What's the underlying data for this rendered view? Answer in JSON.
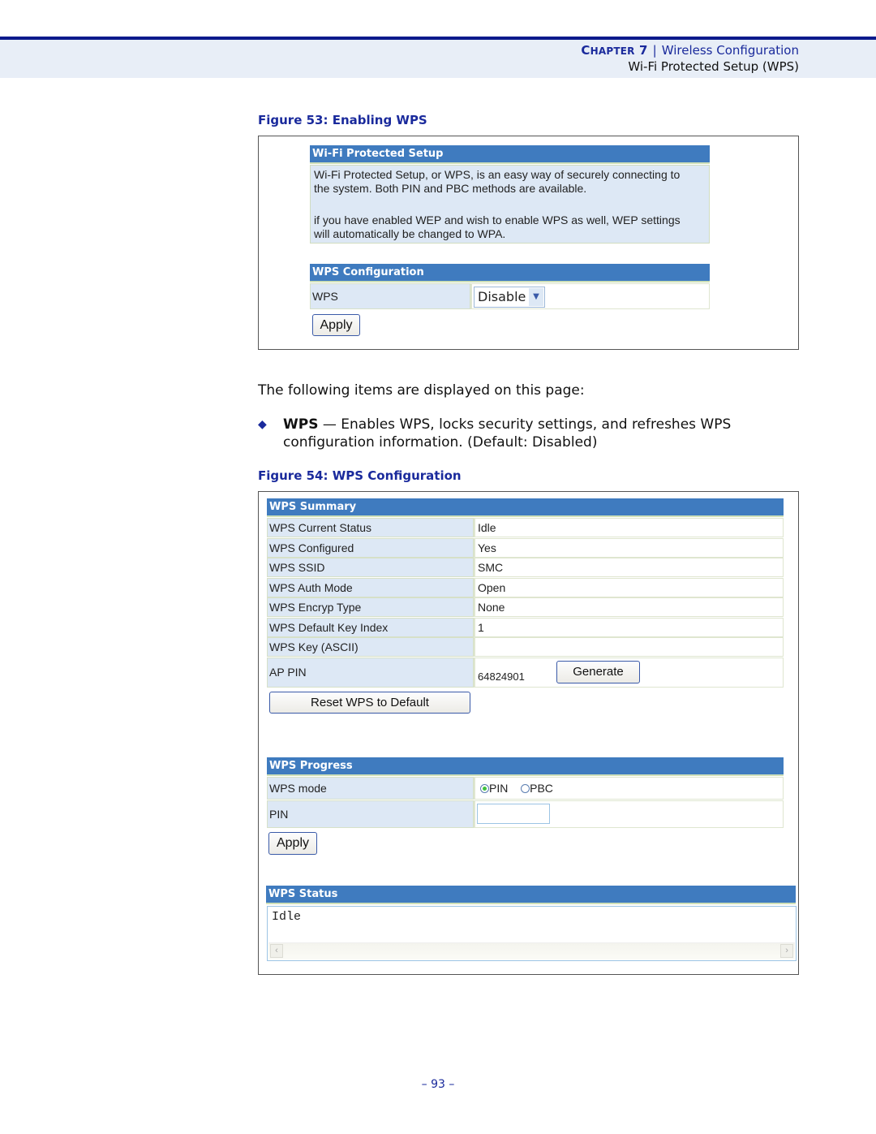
{
  "header": {
    "chapter_prefix": "C",
    "chapter_word": "HAPTER",
    "chapter_number": "7",
    "separator": "|",
    "chapter_title": "Wireless Configuration",
    "section_title": "Wi-Fi Protected Setup (WPS)"
  },
  "figure53": {
    "caption": "Figure 53:  Enabling WPS",
    "setup_header": "Wi-Fi Protected Setup",
    "desc_line1": "Wi-Fi Protected Setup, or WPS, is an easy way of securely connecting to",
    "desc_line2": "the system. Both PIN and PBC methods are available.",
    "desc_line3": "if you have enabled WEP and wish to enable WPS as well, WEP settings",
    "desc_line4": "will automatically be changed to WPA.",
    "config_header": "WPS Configuration",
    "wps_label": "WPS",
    "wps_select_value": "Disable",
    "apply_label": "Apply"
  },
  "body": {
    "intro": "The following items are displayed on this page:",
    "bullet_glyph": "◆",
    "item_term": "WPS",
    "item_desc_line1": " — Enables WPS, locks security settings, and refreshes WPS",
    "item_desc_line2": "configuration information. (Default: Disabled)"
  },
  "figure54": {
    "caption": "Figure 54:  WPS Configuration",
    "summary_header": "WPS Summary",
    "summary_rows": [
      {
        "label": "WPS Current Status",
        "value": "Idle"
      },
      {
        "label": "WPS Configured",
        "value": "Yes"
      },
      {
        "label": "WPS SSID",
        "value": "SMC"
      },
      {
        "label": "WPS Auth Mode",
        "value": "Open"
      },
      {
        "label": "WPS Encryp Type",
        "value": "None"
      },
      {
        "label": "WPS Default Key Index",
        "value": "1"
      },
      {
        "label": "WPS Key (ASCII)",
        "value": ""
      }
    ],
    "ap_pin_label": "AP PIN",
    "ap_pin_value": "64824901",
    "generate_label": "Generate",
    "reset_label": "Reset WPS to Default",
    "progress_header": "WPS Progress",
    "mode_label": "WPS mode",
    "mode_options": [
      "PIN",
      "PBC"
    ],
    "mode_selected": "PIN",
    "pin_label": "PIN",
    "pin_value": "",
    "apply_label": "Apply",
    "status_header": "WPS Status",
    "status_text": "Idle"
  },
  "footer": {
    "page_number": "–  93  –"
  }
}
